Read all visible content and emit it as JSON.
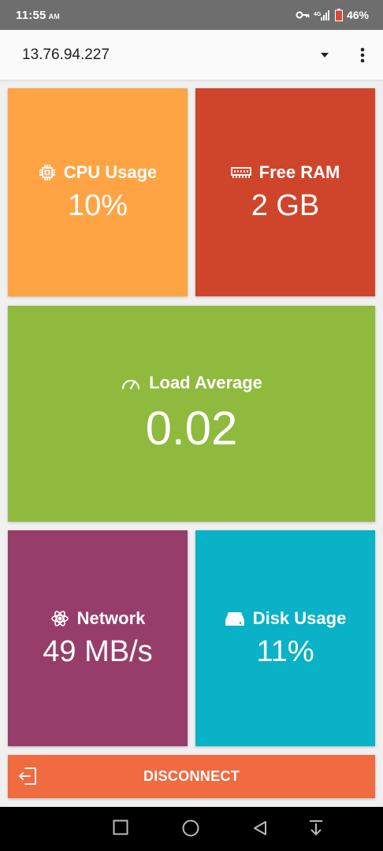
{
  "status": {
    "time": "11:55",
    "ampm": "AM",
    "battery": "46%"
  },
  "appbar": {
    "host": "13.76.94.227",
    "dropdown_icon": "caret-down-icon",
    "menu_icon": "more-vert-icon"
  },
  "tiles": {
    "cpu": {
      "label": "CPU Usage",
      "value": "10%",
      "icon": "chip-icon",
      "color": "#ffa444"
    },
    "ram": {
      "label": "Free RAM",
      "value": "2 GB",
      "icon": "memory-icon",
      "color": "#cf452c"
    },
    "load": {
      "label": "Load Average",
      "value": "0.02",
      "icon": "speedometer-icon",
      "color": "#8fba3e"
    },
    "network": {
      "label": "Network",
      "value": "49 MB/s",
      "icon": "atom-icon",
      "color": "#963e69"
    },
    "disk": {
      "label": "Disk Usage",
      "value": "11%",
      "icon": "hard-drive-icon",
      "color": "#09b2c6"
    }
  },
  "disconnect": {
    "label": "DISCONNECT",
    "icon": "exit-icon",
    "color": "#f06b40"
  },
  "nav": {
    "recents_icon": "square-icon",
    "home_icon": "circle-icon",
    "back_icon": "triangle-back-icon",
    "extra_icon": "down-arrow-icon"
  }
}
